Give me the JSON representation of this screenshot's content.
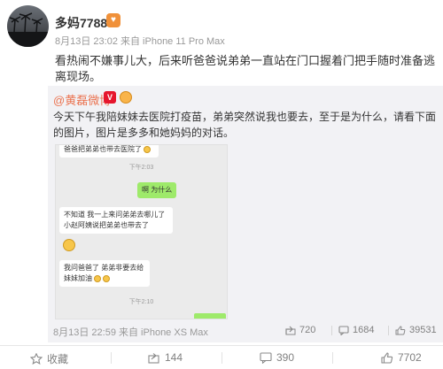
{
  "post": {
    "username": "多妈7788",
    "vip_badge": "♥",
    "meta": "8月13日 23:02 来自 iPhone 11 Pro Max",
    "text": "看热闹不嫌事儿大，后来听爸爸说弟弟一直站在门口握着门把手随时准备逃离现场。"
  },
  "repost": {
    "author": "@黄磊微博",
    "v_badge": "V",
    "text": "今天下午我陪妹妹去医院打疫苗，弟弟突然说我也要去，至于是为什么，请看下面的图片，图片是多多和她妈妈的对话。",
    "chat": {
      "top_bubble": "爸爸把弟弟也带去医院了",
      "time1": "下午2:03",
      "reply": "啊 为什么",
      "answer": "不知道 我一上来问弟弟去哪儿了 小赵阿姨说把弟弟也带去了",
      "last_msg": "我问爸爸了 弟弟非要去给妹妹加油",
      "time2": "下午2:10"
    },
    "meta": "8月13日 22:59 来自 iPhone XS Max",
    "stats": {
      "reposts": "720",
      "comments": "1684",
      "likes": "39531"
    }
  },
  "actions": {
    "favorite": "收藏",
    "repost": "144",
    "comment": "390",
    "like": "7702"
  }
}
